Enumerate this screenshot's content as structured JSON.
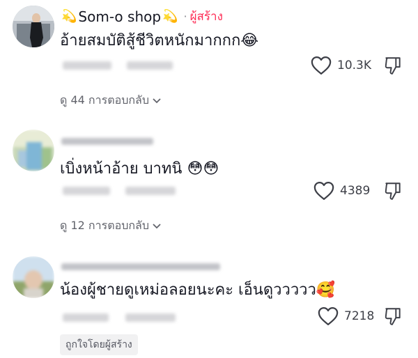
{
  "comments": [
    {
      "author": "Som-o shop",
      "author_prefix_emoji": "💫",
      "author_suffix_emoji": "💫",
      "separator": "·",
      "creator_label": "ผู้สร้าง",
      "text": "อ้ายสมบัติสู้ชีวิตหนักมากกก",
      "text_emoji": "😂",
      "likes": "10.3K",
      "replies_label": "ดู 44 การตอบกลับ"
    },
    {
      "text": "เบิ่งหน้าอ้าย บาทนิ",
      "text_emoji": "😳😳",
      "likes": "4389",
      "replies_label": "ดู 12 การตอบกลับ"
    },
    {
      "text": "น้องผู้ชายดูเหม่อลอยนะคะ เอ็นดูววววว",
      "text_emoji": "🥰",
      "likes": "7218",
      "liked_by_creator_label": "ถูกใจโดยผู้สร้าง"
    }
  ],
  "icons": {
    "like": "heart-outline-icon",
    "dislike": "thumbs-down-icon",
    "expand": "chevron-down-icon"
  },
  "colors": {
    "creator": "#fe2c55",
    "text": "#161823",
    "muted": "#61636b"
  }
}
